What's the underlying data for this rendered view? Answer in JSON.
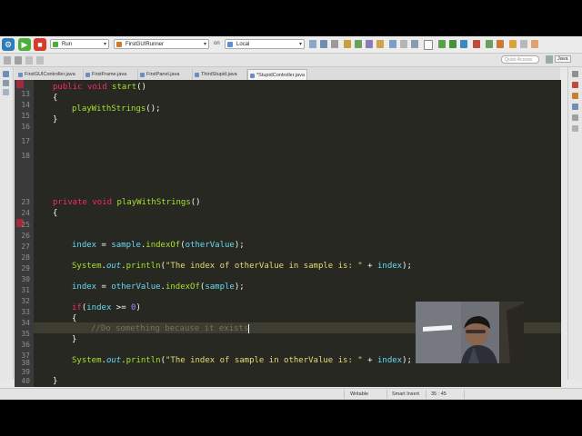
{
  "toolbar": {
    "run_config": "Run",
    "launch_target": "FirstGUIRunner",
    "on_label": "on",
    "launch_location": "Local"
  },
  "search": {
    "placeholder": "Quick Access"
  },
  "perspective": {
    "label": "Java"
  },
  "tabs": [
    {
      "label": "FirstGUIController.java"
    },
    {
      "label": "FirstFrame.java"
    },
    {
      "label": "FirstPanel.java"
    },
    {
      "label": "ThirdStupid.java"
    },
    {
      "label": "*StupidController.java",
      "close": "✕"
    }
  ],
  "editor": {
    "line_numbers": [
      "13",
      "14",
      "15",
      "16",
      "17",
      "18",
      "23",
      "24",
      "25",
      "26",
      "27",
      "28",
      "29",
      "30",
      "31",
      "32",
      "33",
      "34",
      "35",
      "36",
      "37",
      "38",
      "39",
      "40"
    ]
  },
  "status": {
    "mode": "Writable",
    "insert": "Smart Insert",
    "position": "35 : 45"
  },
  "colors": {
    "editor_bg": "#272822",
    "keyword": "#f92672",
    "method": "#a6e22e",
    "field": "#66d9ef",
    "string": "#e6db74",
    "number": "#ae81ff",
    "comment": "#75715e"
  }
}
